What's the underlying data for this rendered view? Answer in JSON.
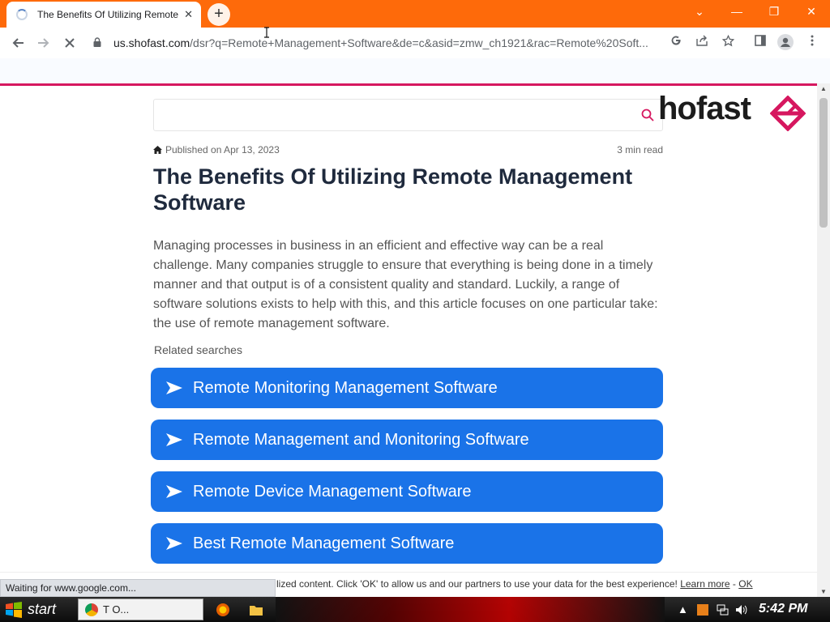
{
  "browser": {
    "tab_title": "The Benefits Of Utilizing Remote Management Software",
    "tab_close": "✕",
    "new_tab": "+",
    "window_controls": {
      "dropdown": "⌄",
      "minimize": "—",
      "restore": "❐",
      "close": "✕"
    },
    "url_host": "us.shofast.com",
    "url_path": "/dsr?q=Remote+Management+Software&de=c&asid=zmw_ch1921&rac=Remote%20Soft...",
    "status_text": "Waiting for www.google.com..."
  },
  "site": {
    "logo_text": "hofast",
    "accent_color": "#d6175f",
    "button_color": "#1a73e8"
  },
  "article": {
    "published": "Published on Apr 13, 2023",
    "read_time": "3 min read",
    "title": "The Benefits Of Utilizing Remote Management Software",
    "intro": "Managing processes in business in an efficient and effective way can be a real challenge. Many companies struggle to ensure that everything is being done in a timely manner and that output is of a consistent quality and standard. Luckily, a range of software solutions exists to help with this, and this article focuses on one particular take: the use of remote management software.",
    "related_label": "Related searches",
    "related": [
      "Remote Monitoring Management Software",
      "Remote Management and Monitoring Software",
      "Remote Device Management Software",
      "Best Remote Management Software"
    ]
  },
  "cookie": {
    "text": "lized content. Click 'OK' to allow us and our partners to use your data for the best experience!",
    "learn_more": "Learn more",
    "separator": "-",
    "ok": "OK"
  },
  "taskbar": {
    "start_label": "start",
    "task_label": "T                O...",
    "clock": "5:42 PM"
  }
}
